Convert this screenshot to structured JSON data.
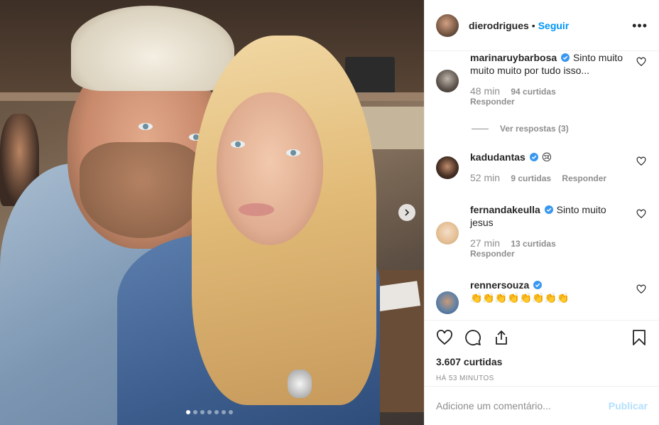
{
  "header": {
    "username": "dierodrigues",
    "separator": "•",
    "follow_label": "Seguir",
    "more_label": "•••"
  },
  "carousel": {
    "slides": 7,
    "active_index": 0
  },
  "comments": [
    {
      "username": "marinaruybarbosa",
      "verified": true,
      "text": "Sinto muito muito muito por tudo isso...",
      "time": "48 min",
      "likes": "94 curtidas",
      "reply": "Responder",
      "view_replies": "Ver respostas (3)"
    },
    {
      "username": "kadudantas",
      "verified": true,
      "text": "😢",
      "time": "52 min",
      "likes": "9 curtidas",
      "reply": "Responder"
    },
    {
      "username": "fernandakeulla",
      "verified": true,
      "text": "Sinto muito jesus",
      "time": "27 min",
      "likes": "13 curtidas",
      "reply": "Responder"
    },
    {
      "username": "rennersouza",
      "verified": true,
      "text": "👏👏👏👏👏👏👏👏"
    }
  ],
  "actions": {
    "likes": "3.607 curtidas",
    "timestamp": "HÁ 53 MINUTOS"
  },
  "add_comment": {
    "placeholder": "Adicione um comentário...",
    "publish_label": "Publicar"
  },
  "colors": {
    "accent": "#0095f6",
    "publish_disabled": "#b2dffc",
    "muted": "#8e8e8e",
    "verified": "#3897f0"
  }
}
